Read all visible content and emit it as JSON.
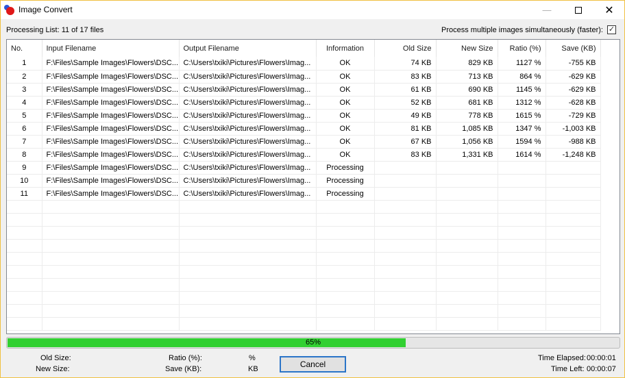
{
  "window": {
    "title": "Image Convert",
    "icon": "app-logo-icon",
    "controls": {
      "minimize": "—",
      "maximize": "",
      "close": "✕"
    }
  },
  "header": {
    "processing_list": "Processing List: 11 of 17 files",
    "multi_label": "Process multiple images simultaneously (faster):",
    "multi_checked": true,
    "checkmark": "✓"
  },
  "table": {
    "columns": [
      "No.",
      "Input Filename",
      "Output Filename",
      "Information",
      "Old Size",
      "New Size",
      "Ratio (%)",
      "Save (KB)"
    ],
    "rows": [
      {
        "no": "1",
        "input": "F:\\Files\\Sample Images\\Flowers\\DSC...",
        "output": "C:\\Users\\txiki\\Pictures\\Flowers\\Imag...",
        "info": "OK",
        "old": "74 KB",
        "new": "829 KB",
        "ratio": "1127 %",
        "save": "-755 KB"
      },
      {
        "no": "2",
        "input": "F:\\Files\\Sample Images\\Flowers\\DSC...",
        "output": "C:\\Users\\txiki\\Pictures\\Flowers\\Imag...",
        "info": "OK",
        "old": "83 KB",
        "new": "713 KB",
        "ratio": "864 %",
        "save": "-629 KB"
      },
      {
        "no": "3",
        "input": "F:\\Files\\Sample Images\\Flowers\\DSC...",
        "output": "C:\\Users\\txiki\\Pictures\\Flowers\\Imag...",
        "info": "OK",
        "old": "61 KB",
        "new": "690 KB",
        "ratio": "1145 %",
        "save": "-629 KB"
      },
      {
        "no": "4",
        "input": "F:\\Files\\Sample Images\\Flowers\\DSC...",
        "output": "C:\\Users\\txiki\\Pictures\\Flowers\\Imag...",
        "info": "OK",
        "old": "52 KB",
        "new": "681 KB",
        "ratio": "1312 %",
        "save": "-628 KB"
      },
      {
        "no": "5",
        "input": "F:\\Files\\Sample Images\\Flowers\\DSC...",
        "output": "C:\\Users\\txiki\\Pictures\\Flowers\\Imag...",
        "info": "OK",
        "old": "49 KB",
        "new": "778 KB",
        "ratio": "1615 %",
        "save": "-729 KB"
      },
      {
        "no": "6",
        "input": "F:\\Files\\Sample Images\\Flowers\\DSC...",
        "output": "C:\\Users\\txiki\\Pictures\\Flowers\\Imag...",
        "info": "OK",
        "old": "81 KB",
        "new": "1,085 KB",
        "ratio": "1347 %",
        "save": "-1,003 KB"
      },
      {
        "no": "7",
        "input": "F:\\Files\\Sample Images\\Flowers\\DSC...",
        "output": "C:\\Users\\txiki\\Pictures\\Flowers\\Imag...",
        "info": "OK",
        "old": "67 KB",
        "new": "1,056 KB",
        "ratio": "1594 %",
        "save": "-988 KB"
      },
      {
        "no": "8",
        "input": "F:\\Files\\Sample Images\\Flowers\\DSC...",
        "output": "C:\\Users\\txiki\\Pictures\\Flowers\\Imag...",
        "info": "OK",
        "old": "83 KB",
        "new": "1,331 KB",
        "ratio": "1614 %",
        "save": "-1,248 KB"
      },
      {
        "no": "9",
        "input": "F:\\Files\\Sample Images\\Flowers\\DSC...",
        "output": "C:\\Users\\txiki\\Pictures\\Flowers\\Imag...",
        "info": "Processing",
        "old": "",
        "new": "",
        "ratio": "",
        "save": ""
      },
      {
        "no": "10",
        "input": "F:\\Files\\Sample Images\\Flowers\\DSC...",
        "output": "C:\\Users\\txiki\\Pictures\\Flowers\\Imag...",
        "info": "Processing",
        "old": "",
        "new": "",
        "ratio": "",
        "save": ""
      },
      {
        "no": "11",
        "input": "F:\\Files\\Sample Images\\Flowers\\DSC...",
        "output": "C:\\Users\\txiki\\Pictures\\Flowers\\Imag...",
        "info": "Processing",
        "old": "",
        "new": "",
        "ratio": "",
        "save": ""
      }
    ],
    "empty_rows": 10
  },
  "progress": {
    "value": 0.65,
    "label": "65%",
    "color": "#32d032"
  },
  "footer": {
    "old_size_label": "Old Size:",
    "new_size_label": "New Size:",
    "ratio_label": "Ratio (%):",
    "ratio_unit": "%",
    "save_label": "Save (KB):",
    "save_unit": "KB",
    "cancel_label": "Cancel",
    "time_elapsed_label": "Time Elapsed:",
    "time_elapsed": "00:00:01",
    "time_left_label": "Time Left:",
    "time_left": "00:00:07"
  }
}
